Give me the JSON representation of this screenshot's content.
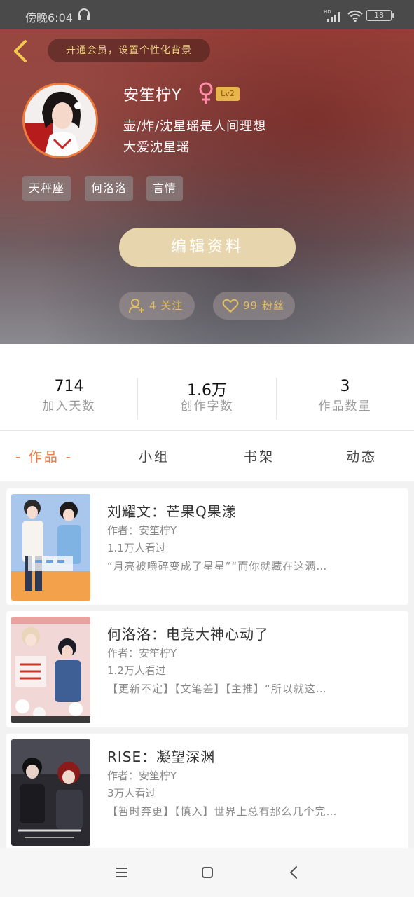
{
  "status_bar": {
    "time": "傍晚6:04",
    "battery": "18"
  },
  "header": {
    "vip_banner": "开通会员，设置个性化背景"
  },
  "profile": {
    "username": "安笙柠Y",
    "level": "Lv2",
    "bio_line1": "壶/炸/沈星瑶是人间理想",
    "bio_line2": "大爱沈星瑶",
    "tags": [
      "天秤座",
      "何洛洛",
      "言情"
    ],
    "edit_button": "编辑资料",
    "follow_label": "4 关注",
    "fans_label": "99 粉丝"
  },
  "stats": [
    {
      "value": "714",
      "label": "加入天数"
    },
    {
      "value": "1.6万",
      "label": "创作字数"
    },
    {
      "value": "3",
      "label": "作品数量"
    }
  ],
  "tabs": [
    {
      "label": "- 作品 -",
      "active": true
    },
    {
      "label": "小组",
      "active": false
    },
    {
      "label": "书架",
      "active": false
    },
    {
      "label": "动态",
      "active": false
    }
  ],
  "works": [
    {
      "title": "刘耀文：芒果Q果漾",
      "author": "作者：安笙柠Y",
      "reads": "1.1万人看过",
      "summary": "“月亮被嚼碎变成了星星”“而你就藏在这满…"
    },
    {
      "title": "何洛洛：电竞大神心动了",
      "author": "作者：安笙柠Y",
      "reads": "1.2万人看过",
      "summary": "【更新不定】【文笔差】【主推】“所以就这…"
    },
    {
      "title": "RISE：凝望深渊",
      "author": "作者：安笙柠Y",
      "reads": "3万人看过",
      "summary": "【暂时弃更】【慎入】世界上总有那么几个完…"
    }
  ],
  "colors": {
    "accent": "#ee7b45",
    "gold": "#e2bf62",
    "edit_button": "#e6d5ad"
  },
  "icons": [
    "headset-icon",
    "signal-icon",
    "wifi-icon",
    "back-arrow-icon",
    "female-icon",
    "add-person-icon",
    "heart-icon",
    "menu-icon",
    "home-icon",
    "back-icon"
  ]
}
